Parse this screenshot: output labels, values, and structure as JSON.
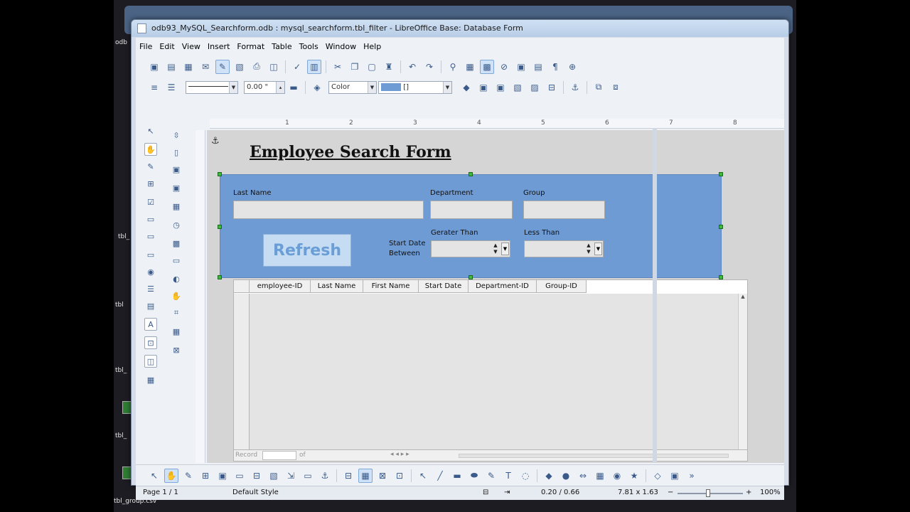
{
  "desktop": {
    "icon_labels": [
      "odb",
      "tbl_",
      "tbl",
      "tbl_",
      "tbl_",
      "tbl_group.csv"
    ]
  },
  "window": {
    "title": "odb93_MySQL_Searchform.odb : mysql_searchform.tbl_filter - LibreOffice Base: Database Form"
  },
  "menu": [
    "File",
    "Edit",
    "View",
    "Insert",
    "Format",
    "Table",
    "Tools",
    "Window",
    "Help"
  ],
  "format_toolbar": {
    "line_width": "0.00 \"",
    "area_style": "Color",
    "fill_value": "[]"
  },
  "ruler": [
    "1",
    "2",
    "3",
    "4",
    "5",
    "6",
    "7",
    "8"
  ],
  "form": {
    "title": "Employee Search Form",
    "labels": {
      "last_name": "Last Name",
      "department": "Department",
      "group": "Group",
      "greater_than": "Gerater Than",
      "less_than": "Less Than",
      "start_date_line1": "Start Date",
      "start_date_line2": "Between"
    },
    "refresh_label": "Refresh"
  },
  "grid": {
    "columns": [
      "employee-ID",
      "Last Name",
      "First Name",
      "Start Date",
      "Department-ID",
      "Group-ID"
    ],
    "record_label": "Record",
    "of_label": "of"
  },
  "status": {
    "page": "Page 1 / 1",
    "style": "Default Style",
    "position": "0.20 / 0.66",
    "size": "7.81 x 1.63",
    "zoom": "100%"
  },
  "colors": {
    "form_panel": "#6e9bd4",
    "refresh_text": "#6a9ed6"
  }
}
